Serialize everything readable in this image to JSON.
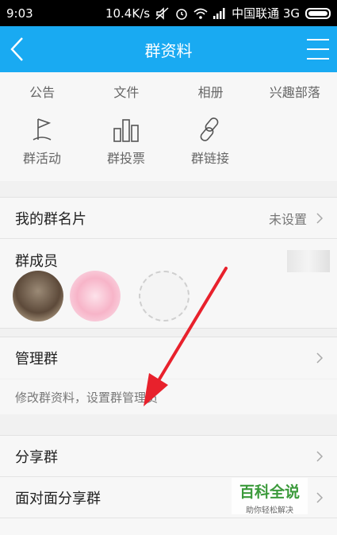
{
  "status_bar": {
    "time": "9:03",
    "speed": "10.4K/s",
    "carrier": "中国联通 3G"
  },
  "header": {
    "title": "群资料"
  },
  "grid": {
    "row1": [
      "公告",
      "文件",
      "相册",
      "兴趣部落"
    ],
    "row2": [
      "群活动",
      "群投票",
      "群链接"
    ]
  },
  "group_card": {
    "label": "我的群名片",
    "value": "未设置"
  },
  "members": {
    "label": "群成员"
  },
  "manage": {
    "label": "管理群",
    "note": "修改群资料，设置群管理员"
  },
  "share": {
    "share_group": "分享群",
    "face_share": "面对面分享群"
  },
  "watermark": {
    "title": "百科全说",
    "subtitle": "助你轻松解决"
  },
  "colors": {
    "accent": "#19aaf2",
    "arrow": "#e8212c"
  }
}
